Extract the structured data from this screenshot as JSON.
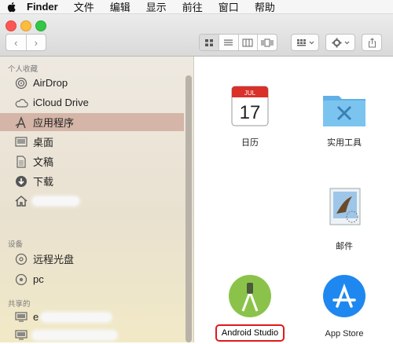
{
  "menubar": {
    "app_name": "Finder",
    "items": [
      "文件",
      "编辑",
      "显示",
      "前往",
      "窗口",
      "帮助"
    ]
  },
  "toolbar": {
    "back_glyph": "‹",
    "forward_glyph": "›",
    "view_modes": [
      "icon-view",
      "list-view",
      "column-view",
      "cover-flow-view"
    ],
    "active_view": "icon-view",
    "arrange_icon": "grid-icon",
    "action_icon": "gear-icon",
    "share_icon": "share-icon"
  },
  "sidebar": {
    "favorites_header": "个人收藏",
    "favorites": [
      {
        "label": "AirDrop",
        "icon": "airdrop-icon"
      },
      {
        "label": "iCloud Drive",
        "icon": "cloud-icon"
      },
      {
        "label": "应用程序",
        "icon": "applications-icon",
        "selected": true
      },
      {
        "label": "桌面",
        "icon": "desktop-icon"
      },
      {
        "label": "文稿",
        "icon": "documents-icon"
      },
      {
        "label": "下载",
        "icon": "download-icon"
      },
      {
        "label": "",
        "icon": "home-icon"
      }
    ],
    "devices_header": "设备",
    "devices": [
      {
        "label": "远程光盘",
        "icon": "disc-icon"
      },
      {
        "label": "pc",
        "icon": "disk-icon"
      }
    ],
    "shared_header": "共享的",
    "shared": [
      {
        "label": "e",
        "icon": "computer-icon"
      },
      {
        "label": "",
        "icon": "computer-icon"
      },
      {
        "label": "",
        "icon": "computer-icon"
      }
    ]
  },
  "apps": [
    {
      "label": "日历",
      "icon": "calendar-icon",
      "month": "JUL",
      "day": "17"
    },
    {
      "label": "实用工具",
      "icon": "utilities-folder-icon"
    },
    {
      "label": "",
      "icon": "blank-app-icon"
    },
    {
      "label": "邮件",
      "icon": "mail-icon"
    },
    {
      "label": "Android Studio",
      "icon": "android-studio-icon",
      "highlighted": true
    },
    {
      "label": "App Store",
      "icon": "app-store-icon"
    }
  ],
  "colors": {
    "selection": "#d4b5a7",
    "highlight_border": "#e0191b",
    "folder_blue": "#6db8e8",
    "android_green": "#8bc34a",
    "app_store_blue": "#1e88f0"
  }
}
